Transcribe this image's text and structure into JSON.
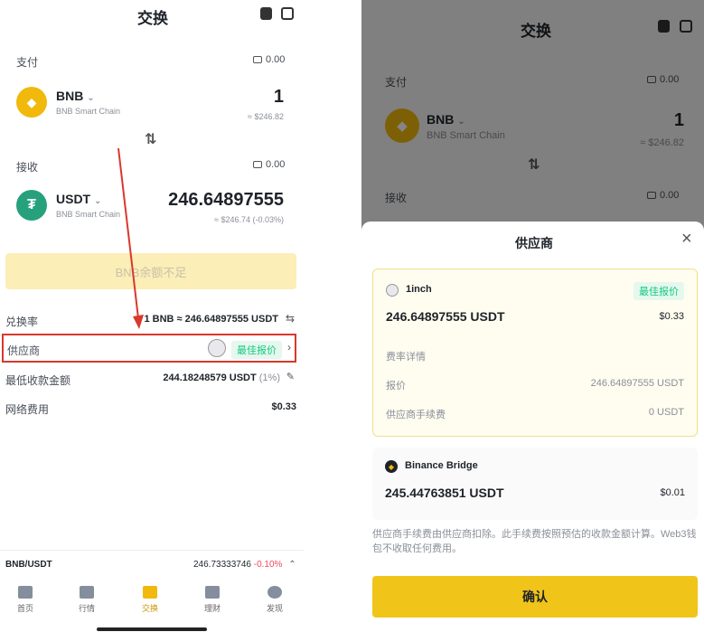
{
  "left": {
    "title": "交换",
    "pay": {
      "label": "支付",
      "balance": "0.00",
      "token": "BNB",
      "chain": "BNB Smart Chain",
      "amount": "1",
      "usd": "≈ $246.82"
    },
    "receive": {
      "label": "接收",
      "balance": "0.00",
      "token": "USDT",
      "chain": "BNB Smart Chain",
      "amount": "246.64897555",
      "usd": "≈ $246.74 (-0.03%)"
    },
    "insufficient_button": "BNB余额不足",
    "rate": {
      "label": "兑换率",
      "value": "1 BNB ≈ 246.64897555 USDT"
    },
    "provider": {
      "label": "供应商",
      "badge": "最佳报价"
    },
    "min_receive": {
      "label": "最低收款金额",
      "value": "244.18248579 USDT",
      "pct": "(1%)"
    },
    "network_fee": {
      "label": "网络费用",
      "value": "$0.33"
    },
    "ticker": {
      "pair": "BNB/USDT",
      "price": "246.73333746",
      "change": "-0.10%"
    },
    "nav": [
      "首页",
      "行情",
      "交换",
      "理财",
      "发现"
    ],
    "accent": "#f0b90b",
    "arrow_color": "#d9382c"
  },
  "right": {
    "title": "交换",
    "pay": {
      "label": "支付",
      "balance": "0.00",
      "token": "BNB",
      "chain": "BNB Smart Chain",
      "amount": "1",
      "usd": "≈ $246.82"
    },
    "receive": {
      "label": "接收",
      "balance": "0.00"
    },
    "sheet": {
      "title": "供应商",
      "close": "×",
      "providers": [
        {
          "name": "1inch",
          "badge": "最佳报价",
          "amount": "246.64897555 USDT",
          "fee": "$0.33",
          "details_title": "费率详情",
          "quote_label": "报价",
          "quote_value": "246.64897555 USDT",
          "provider_fee_label": "供应商手续费",
          "provider_fee_value": "0 USDT"
        },
        {
          "name": "Binance Bridge",
          "amount": "245.44763851 USDT",
          "fee": "$0.01"
        }
      ],
      "note": "供应商手续费由供应商扣除。此手续费按照预估的收款金额计算。Web3钱包不收取任何费用。",
      "confirm": "确认"
    }
  }
}
